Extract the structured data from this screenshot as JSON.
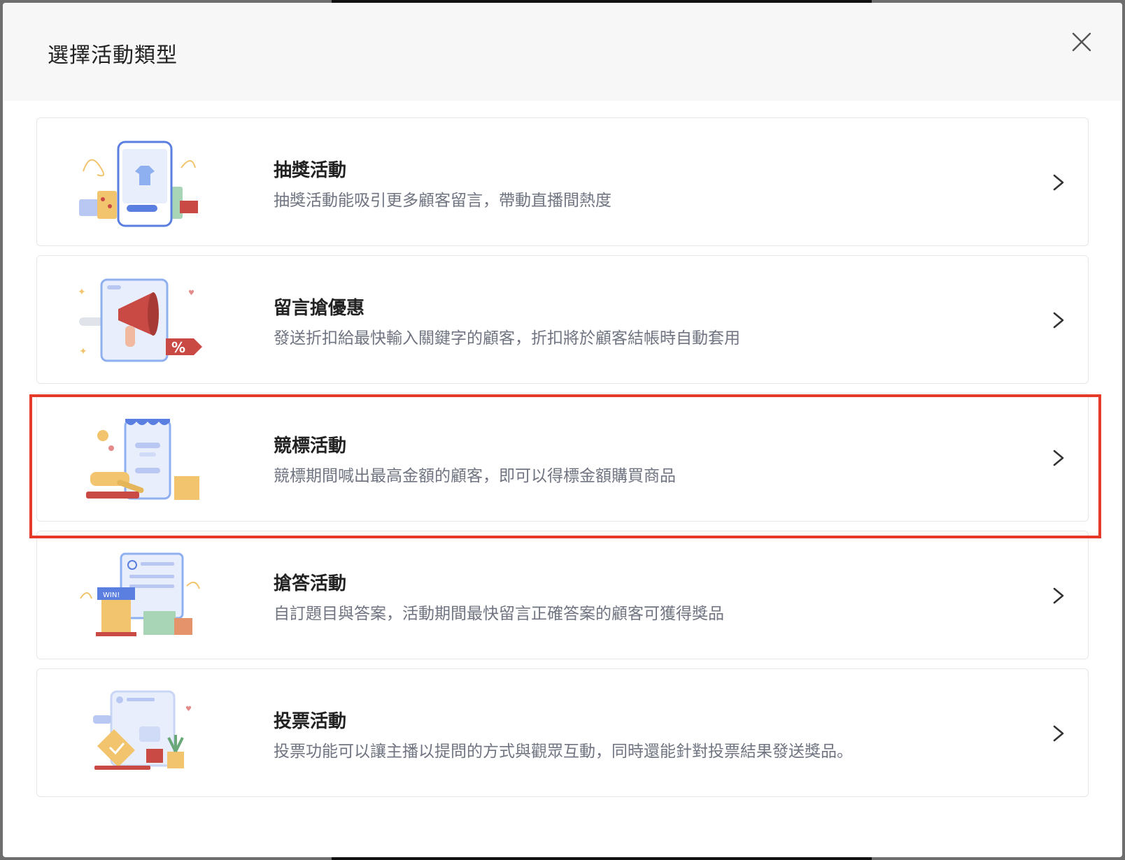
{
  "modal": {
    "title": "選擇活動類型",
    "close_icon": "close-icon"
  },
  "activities": [
    {
      "id": "lottery",
      "title": "抽獎活動",
      "description": "抽獎活動能吸引更多顧客留言，帶動直播間熱度",
      "illustration": "lottery-illustration",
      "arrow_icon": "chevron-right-icon"
    },
    {
      "id": "comment-deal",
      "title": "留言搶優惠",
      "description": "發送折扣給最快輸入關鍵字的顧客，折扣將於顧客結帳時自動套用",
      "illustration": "megaphone-discount-illustration",
      "arrow_icon": "chevron-right-icon"
    },
    {
      "id": "auction",
      "title": "競標活動",
      "description": "競標期間喊出最高金額的顧客，即可以得標金額購買商品",
      "illustration": "auction-gavel-illustration",
      "arrow_icon": "chevron-right-icon",
      "highlighted": true
    },
    {
      "id": "quiz",
      "title": "搶答活動",
      "description": "自訂題目與答案，活動期間最快留言正確答案的顧客可獲得獎品",
      "illustration": "quiz-podium-illustration",
      "arrow_icon": "chevron-right-icon"
    },
    {
      "id": "vote",
      "title": "投票活動",
      "description": "投票功能可以讓主播以提問的方式與觀眾互動，同時還能針對投票結果發送獎品。",
      "illustration": "vote-ballot-illustration",
      "arrow_icon": "chevron-right-icon"
    }
  ],
  "colors": {
    "highlight_border": "#e53a2a",
    "accent_blue": "#5b7fe0",
    "accent_red": "#c94a44",
    "accent_yellow": "#f2c46d"
  }
}
